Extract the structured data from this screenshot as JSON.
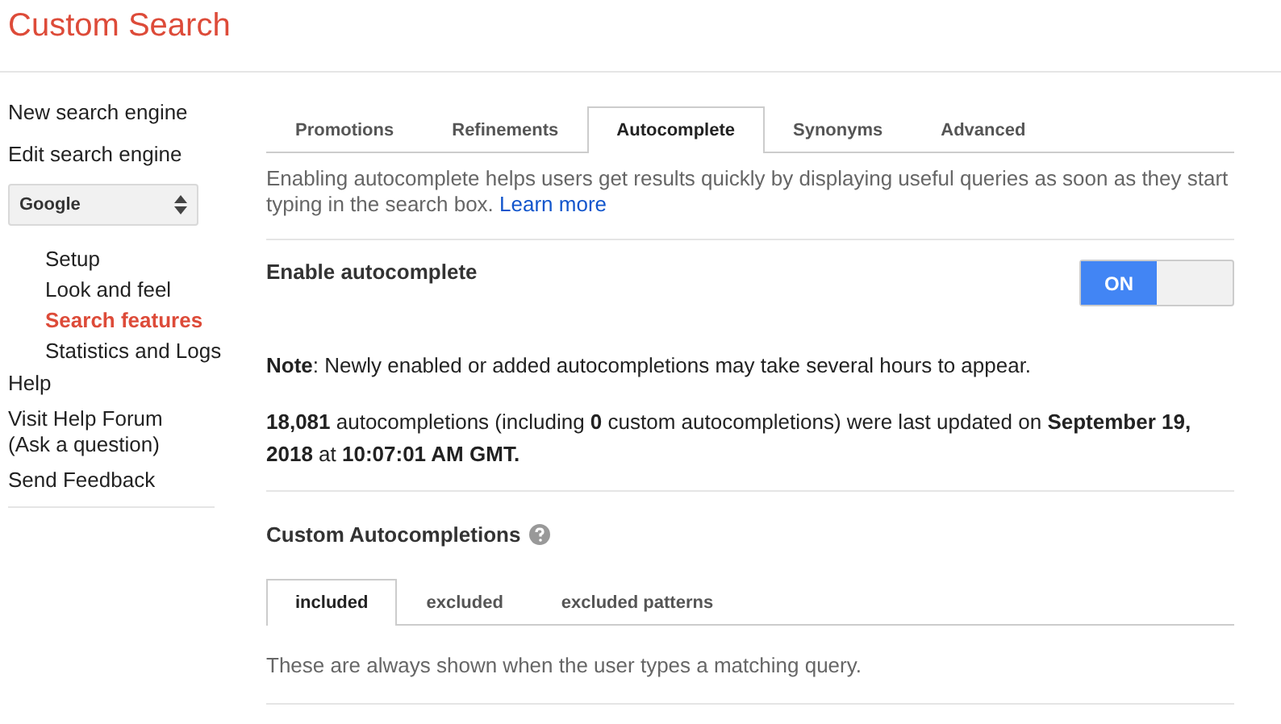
{
  "header": {
    "title": "Custom Search"
  },
  "sidebar": {
    "top_links": [
      "New search engine",
      "Edit search engine"
    ],
    "engine_select": {
      "value": "Google"
    },
    "sub_items": [
      {
        "label": "Setup",
        "selected": false
      },
      {
        "label": "Look and feel",
        "selected": false
      },
      {
        "label": "Search features",
        "selected": true
      },
      {
        "label": "Statistics and Logs",
        "selected": false
      }
    ],
    "bottom_links": [
      "Help",
      "Visit Help Forum\n(Ask a question)",
      "Send Feedback"
    ]
  },
  "tabs": [
    {
      "label": "Promotions",
      "selected": false
    },
    {
      "label": "Refinements",
      "selected": false
    },
    {
      "label": "Autocomplete",
      "selected": true
    },
    {
      "label": "Synonyms",
      "selected": false
    },
    {
      "label": "Advanced",
      "selected": false
    }
  ],
  "description": {
    "text": "Enabling autocomplete helps users get results quickly by displaying useful queries as soon as they start typing in the search box.",
    "link": "Learn more"
  },
  "enable": {
    "label": "Enable autocomplete",
    "on": true,
    "on_text": "ON"
  },
  "note": "**Note**: Newly enabled or added autocompletions may take several hours to appear.",
  "stats": "**18,081** autocompletions (including **0** custom autocompletions) were last updated on **September 19, 2018** at **10:07:01 AM GMT.**",
  "custom": {
    "title": "Custom Autocompletions",
    "tabs": [
      {
        "label": "included",
        "selected": true
      },
      {
        "label": "excluded",
        "selected": false
      },
      {
        "label": "excluded patterns",
        "selected": false
      }
    ],
    "hint": "These are always shown when the user types a matching query."
  }
}
